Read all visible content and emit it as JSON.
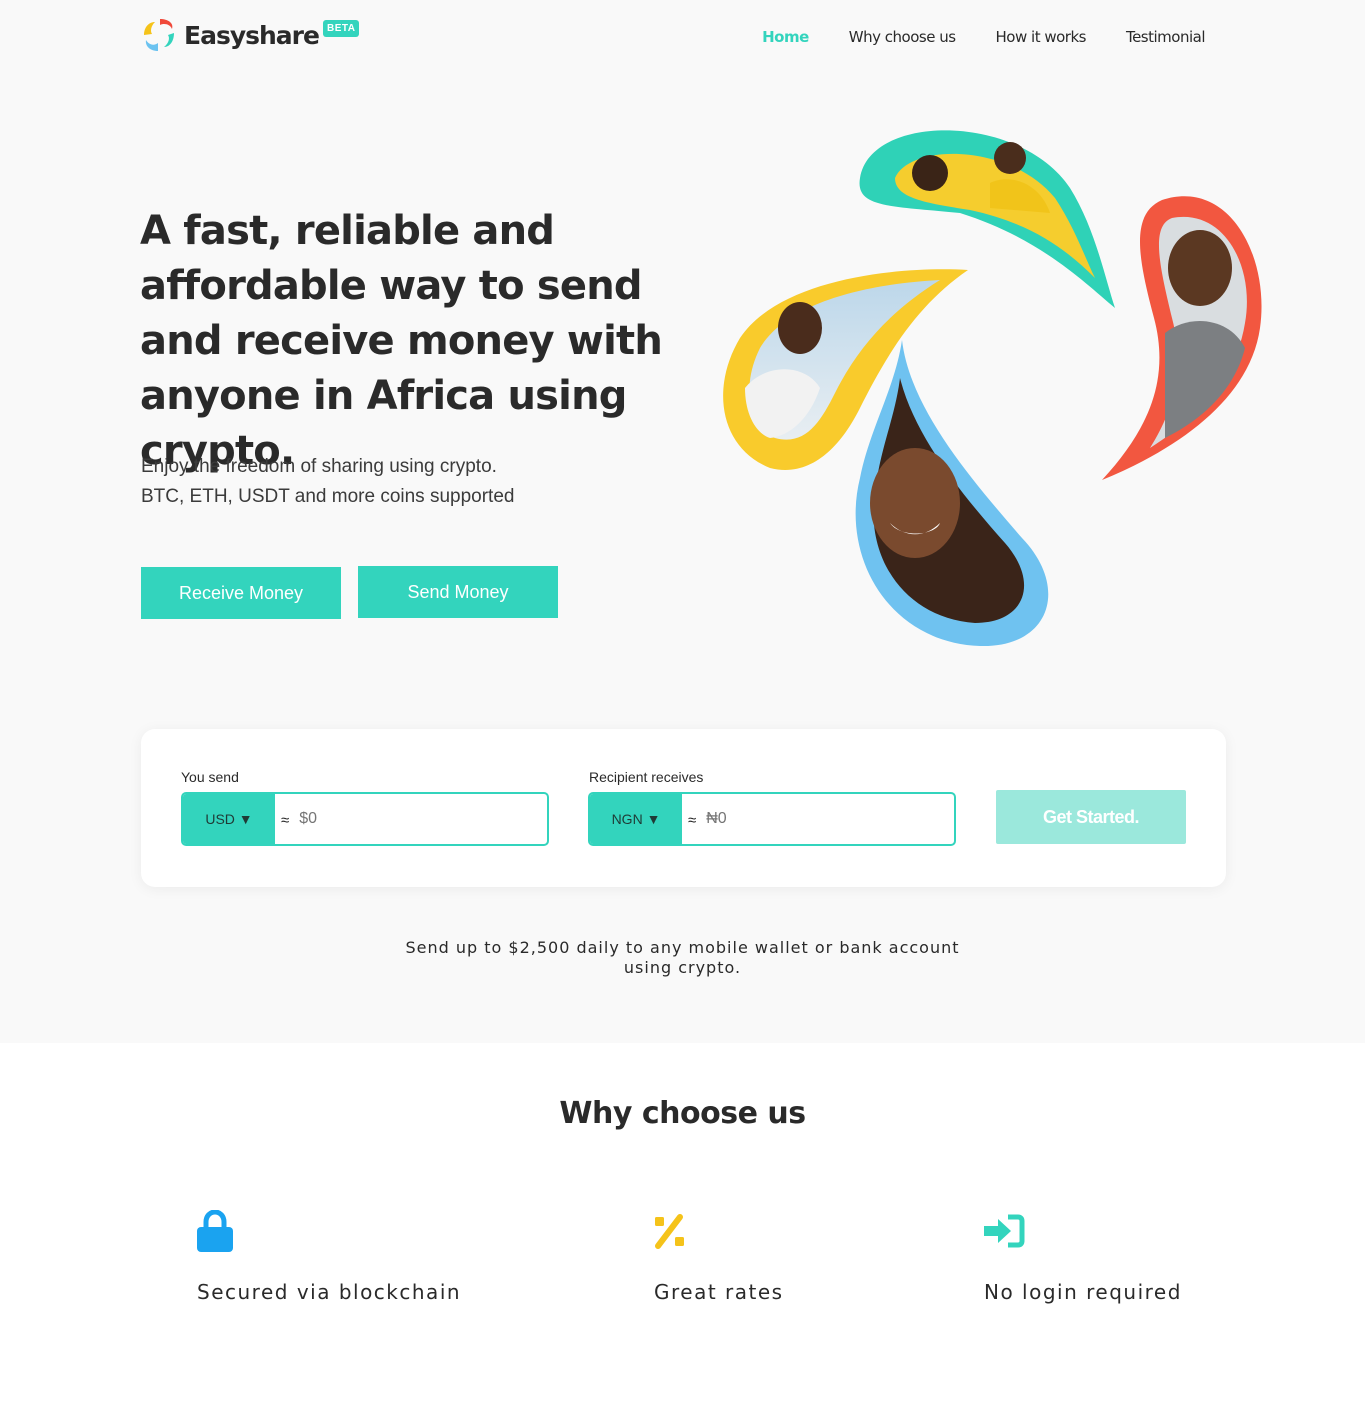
{
  "brand": {
    "name": "Easyshare",
    "badge": "BETA",
    "accent": "#33d4bd"
  },
  "nav": {
    "items": [
      {
        "label": "Home",
        "active": true
      },
      {
        "label": "Why choose us",
        "active": false
      },
      {
        "label": "How it works",
        "active": false
      },
      {
        "label": "Testimonial",
        "active": false
      }
    ]
  },
  "hero": {
    "headline": "A fast, reliable and affordable way to send and receive money with anyone in Africa using crypto.",
    "subline_1": "Enjoy the freedom of sharing using crypto.",
    "subline_2": "BTC, ETH, USDT and more coins supported",
    "receive_label": "Receive Money",
    "send_label": "Send Money"
  },
  "converter": {
    "send_label": "You send",
    "send_currency": "USD",
    "send_value": "$0",
    "receive_label": "Recipient receives",
    "receive_currency": "NGN",
    "receive_value": "₦0",
    "approx": "≈",
    "cta": "Get Started."
  },
  "limit_text": "Send up to $2,500 daily to any mobile wallet or bank account using crypto.",
  "why": {
    "title": "Why choose us",
    "features": [
      {
        "label": "Secured via blockchain",
        "icon": "lock-icon",
        "color": "#1aa3f0"
      },
      {
        "label": "Great rates",
        "icon": "percent-icon",
        "color": "#f5c31a"
      },
      {
        "label": "No login required",
        "icon": "sign-in-icon",
        "color": "#33d4bd"
      }
    ]
  }
}
